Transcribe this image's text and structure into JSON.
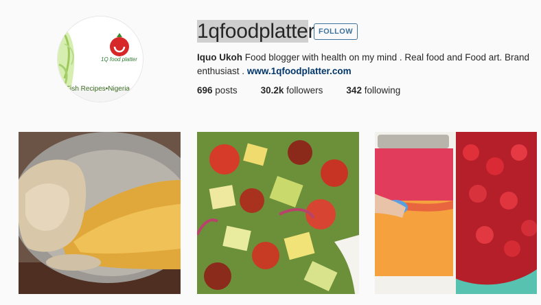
{
  "profile": {
    "username_highlighted": "1qfoodplatte",
    "username_rest": "r",
    "follow_label": "FOLLOW",
    "display_name": "Iquo Ukoh",
    "bio_text": "Food blogger with health on my mind . Real food and Food art. Brand enthusiast .",
    "website": "www.1qfoodplatter.com",
    "avatar_logo_text": "1Q food platter",
    "avatar_tagline": "Fish Recipes•Nigeria"
  },
  "stats": {
    "posts_count": "696",
    "posts_label": "posts",
    "followers_count": "30.2k",
    "followers_label": "followers",
    "following_count": "342",
    "following_label": "following"
  },
  "colors": {
    "accent": "#3f729b",
    "link": "#003569",
    "background": "#fafafa",
    "text": "#262626"
  }
}
